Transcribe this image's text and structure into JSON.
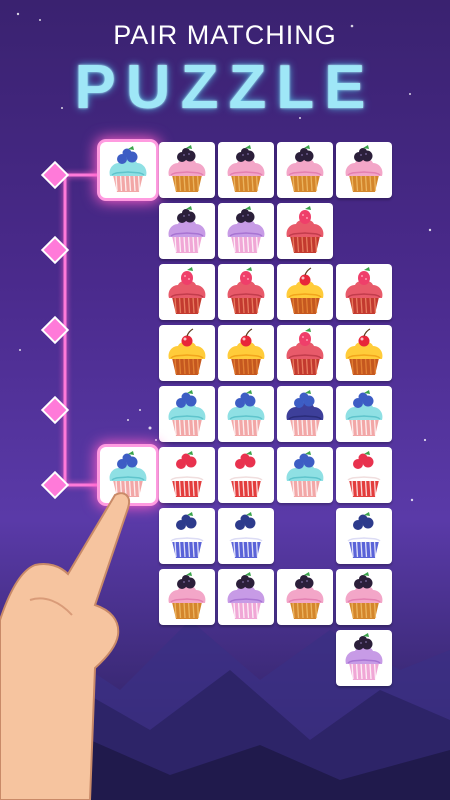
{
  "title": {
    "top": "PAIR MATCHING",
    "main": "PUZZLE"
  },
  "colors": {
    "path": "#ff7ad9",
    "tile": "#ffffff",
    "bg_top": "#3a2270",
    "bg_mid": "#5a3aa8"
  },
  "board": {
    "rows": [
      [
        "blueberry-cupcake",
        "blackberry-cupcake",
        "blackberry-cupcake",
        "blackberry-cupcake",
        "blackberry-cupcake"
      ],
      [
        null,
        "blackberry-purple-cupcake",
        "blackberry-purple-cupcake",
        "raspberry-red-cupcake",
        null
      ],
      [
        null,
        "raspberry-red-cupcake",
        "raspberry-red-cupcake",
        "cherry-yellow-cupcake",
        "raspberry-red-cupcake"
      ],
      [
        null,
        "cherry-yellow-cupcake",
        "cherry-yellow-cupcake",
        "raspberry-red-cupcake",
        "cherry-yellow-cupcake"
      ],
      [
        null,
        "blueberry-cupcake",
        "blueberry-cupcake",
        "blueberry-navy-cupcake",
        "blueberry-cupcake"
      ],
      [
        "blueberry-cupcake",
        "raspberry-polka-cupcake",
        "raspberry-polka-cupcake",
        "blueberry-cupcake",
        "raspberry-polka-cupcake"
      ],
      [
        null,
        "blueberry-star-cupcake",
        "blueberry-star-cupcake",
        null,
        "blueberry-star-cupcake"
      ],
      [
        null,
        "blackberry-cupcake",
        "blackberry-purple-cupcake",
        "blackberry-cupcake",
        "blackberry-cupcake"
      ],
      [
        null,
        null,
        null,
        null,
        "blackberry-purple-cupcake"
      ]
    ],
    "selected": [
      [
        0,
        0
      ],
      [
        5,
        0
      ]
    ]
  }
}
